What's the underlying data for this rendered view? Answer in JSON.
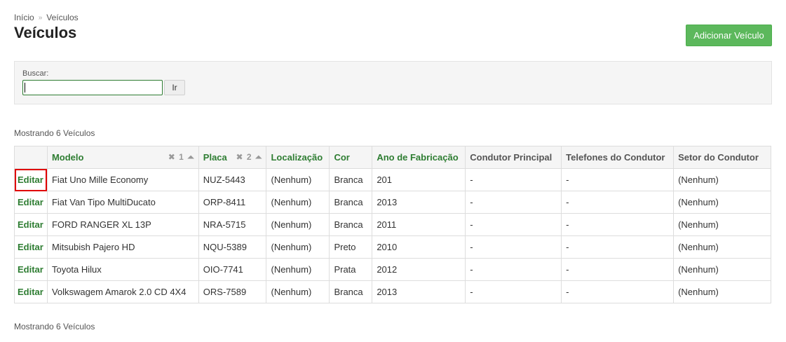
{
  "breadcrumb": {
    "home": "Início",
    "separator": "»",
    "current": "Veículos"
  },
  "page": {
    "title": "Veículos",
    "add_button": "Adicionar Veículo"
  },
  "search": {
    "label": "Buscar:",
    "value": "",
    "go_button": "Ir"
  },
  "results": {
    "count_top": "Mostrando 6 Veículos",
    "count_bottom": "Mostrando 6 Veículos"
  },
  "table": {
    "columns": [
      {
        "label": "",
        "sortable": false
      },
      {
        "label": "Modelo",
        "sortable": true,
        "sort_remove": "✖",
        "sort_priority": "1",
        "sort_dir": "⏶"
      },
      {
        "label": "Placa",
        "sortable": true,
        "sort_remove": "✖",
        "sort_priority": "2",
        "sort_dir": "⏶"
      },
      {
        "label": "Localização",
        "sortable": true
      },
      {
        "label": "Cor",
        "sortable": true
      },
      {
        "label": "Ano de Fabricação",
        "sortable": true
      },
      {
        "label": "Condutor Principal",
        "sortable": false
      },
      {
        "label": "Telefones do Condutor",
        "sortable": false
      },
      {
        "label": "Setor do Condutor",
        "sortable": false
      }
    ],
    "rows": [
      {
        "action": "Editar",
        "modelo": "Fiat Uno Mille Economy",
        "placa": "NUZ-5443",
        "localizacao": "(Nenhum)",
        "cor": "Branca",
        "ano": "201",
        "condutor": "-",
        "telefones": "-",
        "setor": "(Nenhum)"
      },
      {
        "action": "Editar",
        "modelo": "Fiat Van Tipo MultiDucato",
        "placa": "ORP-8411",
        "localizacao": "(Nenhum)",
        "cor": "Branca",
        "ano": "2013",
        "condutor": "-",
        "telefones": "-",
        "setor": "(Nenhum)"
      },
      {
        "action": "Editar",
        "modelo": "FORD RANGER XL 13P",
        "placa": "NRA-5715",
        "localizacao": "(Nenhum)",
        "cor": "Branca",
        "ano": "2011",
        "condutor": "-",
        "telefones": "-",
        "setor": "(Nenhum)"
      },
      {
        "action": "Editar",
        "modelo": "Mitsubish Pajero HD",
        "placa": "NQU-5389",
        "localizacao": "(Nenhum)",
        "cor": "Preto",
        "ano": "2010",
        "condutor": "-",
        "telefones": "-",
        "setor": "(Nenhum)"
      },
      {
        "action": "Editar",
        "modelo": "Toyota Hilux",
        "placa": "OIO-7741",
        "localizacao": "(Nenhum)",
        "cor": "Prata",
        "ano": "2012",
        "condutor": "-",
        "telefones": "-",
        "setor": "(Nenhum)"
      },
      {
        "action": "Editar",
        "modelo": "Volkswagem Amarok 2.0 CD 4X4",
        "placa": "ORS-7589",
        "localizacao": "(Nenhum)",
        "cor": "Branca",
        "ano": "2013",
        "condutor": "-",
        "telefones": "-",
        "setor": "(Nenhum)"
      }
    ]
  },
  "colors": {
    "accent_green": "#2e7d32",
    "button_green": "#5cb85c",
    "highlight_red": "#e00000"
  }
}
